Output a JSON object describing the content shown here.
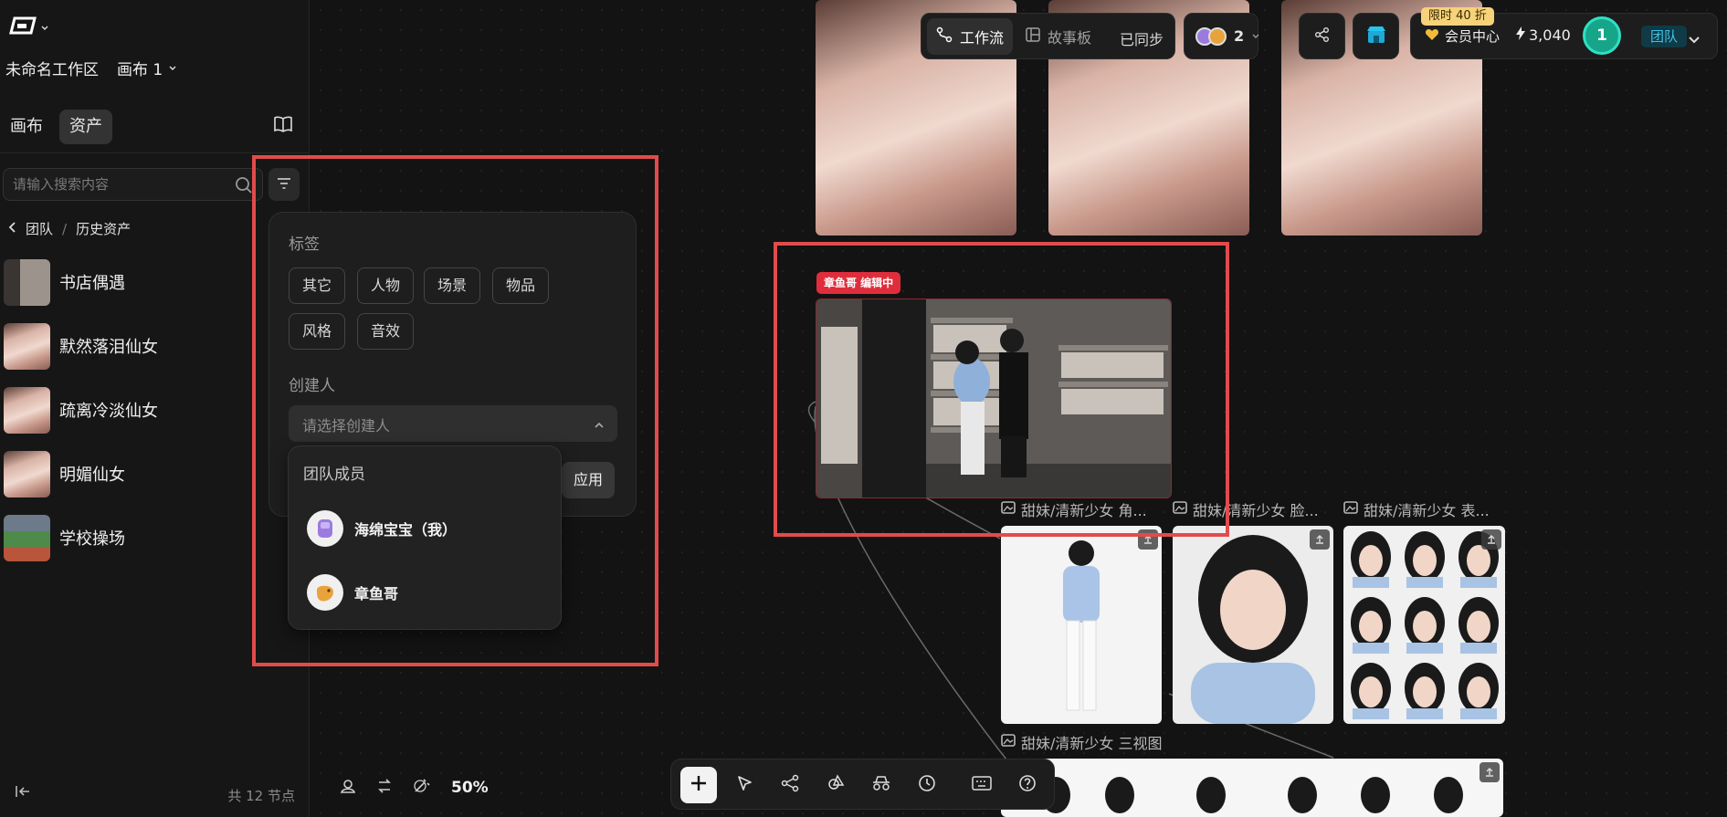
{
  "workspace": {
    "name": "未命名工作区",
    "canvas": "画布 1"
  },
  "sidebar": {
    "tabs": [
      {
        "label": "画布"
      },
      {
        "label": "资产"
      }
    ],
    "search": {
      "placeholder": "请输入搜索内容"
    },
    "breadcrumb": {
      "team": "团队",
      "sep": "/",
      "current": "历史资产"
    },
    "assets": [
      {
        "name": "书店偶遇",
        "thumb": "bookstore"
      },
      {
        "name": "默然落泪仙女",
        "thumb": "fairy"
      },
      {
        "name": "疏离冷淡仙女",
        "thumb": "fairy"
      },
      {
        "name": "明媚仙女",
        "thumb": "fairy"
      },
      {
        "name": "学校操场",
        "thumb": "playground"
      }
    ],
    "footer": {
      "node_count": "共 12 节点"
    }
  },
  "filter": {
    "tags_label": "标签",
    "tags": [
      "其它",
      "人物",
      "场景",
      "物品",
      "风格",
      "音效"
    ],
    "creator_label": "创建人",
    "creator_placeholder": "请选择创建人",
    "apply_label": "应用",
    "dropdown": {
      "header": "团队成员",
      "members": [
        {
          "name": "海绵宝宝（我）",
          "avatar_color": "#8e6ad6"
        },
        {
          "name": "章鱼哥",
          "avatar_color": "#e8a33a"
        }
      ]
    }
  },
  "topbar": {
    "mode_workflow": "工作流",
    "mode_storyboard": "故事板",
    "sync_status": "已同步",
    "collaborators_count": "2",
    "promo": "限时 40 折",
    "member_center": "会员中心",
    "credits": "3,040",
    "user_initial": "1",
    "team_label": "团队"
  },
  "canvas": {
    "edit_tag": "章鱼哥 编辑中",
    "captions": [
      "甜妹/清新少女 角...",
      "甜妹/清新少女 脸...",
      "甜妹/清新少女 表...",
      "甜妹/清新少女 三视图"
    ]
  },
  "zoom": "50%",
  "colors": {
    "highlight": "#e24b4b",
    "accent_teal": "#1fbf9f",
    "edit_red": "#e02d3c"
  }
}
